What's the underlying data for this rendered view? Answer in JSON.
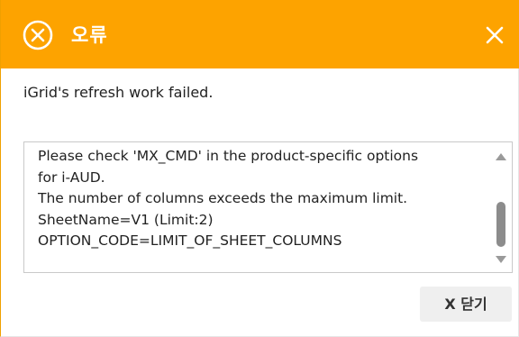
{
  "dialog": {
    "title": "오류",
    "message": "iGrid's refresh work failed.",
    "detail_lines": [
      "Please check 'MX_CMD' in the product-specific options",
      "for i-AUD.",
      "The number of columns exceeds the maximum limit.",
      "SheetName=V1 (Limit:2)",
      "OPTION_CODE=LIMIT_OF_SHEET_COLUMNS"
    ],
    "close_button_label": "X 닫기",
    "scroll_position": 0.6
  },
  "colors": {
    "titlebar": "#fda300",
    "title_text": "#ffffff",
    "button_bg": "#efefef"
  },
  "icons": {
    "title_icon": "error-circle-x-icon",
    "close_icon": "close-icon"
  }
}
